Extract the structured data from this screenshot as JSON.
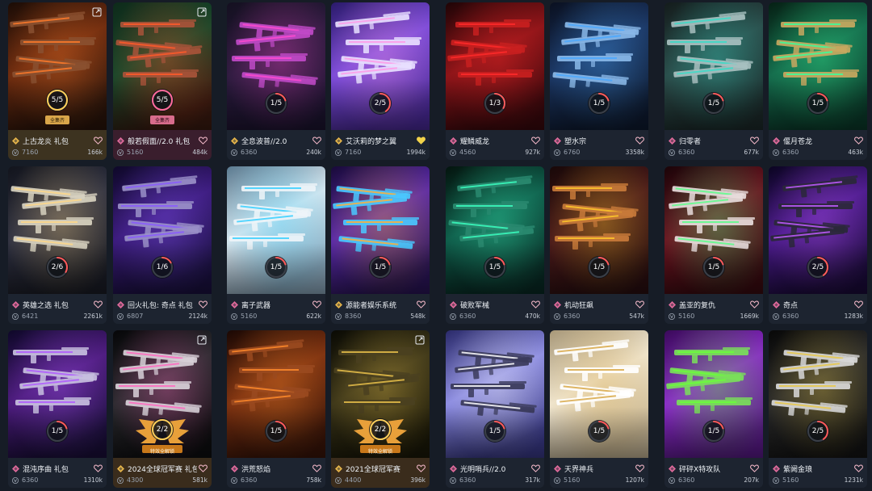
{
  "cards": [
    {
      "name": "上古龙炎 礼包",
      "price": "7160",
      "likes": "166k",
      "progress": "5/5",
      "fraction": 1.0,
      "badge": "全集齐",
      "badge_style": "gold",
      "tier": "exclusive",
      "tier_color": "#e8b64a",
      "liked": false,
      "share": true,
      "info_style": "gold",
      "art": {
        "bg": [
          "#2a140a",
          "#6b2a0e",
          "#1a0c06"
        ],
        "accent": "#ff7a2a",
        "gun": "#8a5030"
      }
    },
    {
      "name": "般若假面//2.0 礼包",
      "price": "5160",
      "likes": "484k",
      "progress": "5/5",
      "fraction": 1.0,
      "badge": "全集齐",
      "badge_style": "pink",
      "tier": "premium",
      "tier_color": "#e06a9c",
      "liked": false,
      "share": true,
      "info_style": "pink",
      "art": {
        "bg": [
          "#3a1a10",
          "#17472a",
          "#0e2a1a"
        ],
        "accent": "#ff5a2a",
        "gun": "#a8543a"
      }
    },
    {
      "name": "全息波普//2.0",
      "price": "6360",
      "likes": "240k",
      "progress": "1/5",
      "fraction": 0.2,
      "tier": "deluxe",
      "tier_color": "#e8b64a",
      "liked": false,
      "share": false,
      "art": {
        "bg": [
          "#1c1430",
          "#2a1a3c",
          "#141020"
        ],
        "accent": "#ff4ad0",
        "gun": "#c04ac8"
      }
    },
    {
      "name": "艾沃莉的梦之翼",
      "price": "7160",
      "likes": "1994k",
      "progress": "2/5",
      "fraction": 0.4,
      "tier": "exclusive",
      "tier_color": "#e8b64a",
      "liked": true,
      "share": false,
      "art": {
        "bg": [
          "#4a2a9a",
          "#7a4ad8",
          "#2a1a6a"
        ],
        "accent": "#ff9ae8",
        "gun": "#e8e0ff"
      }
    },
    {
      "name": "耀鳞威龙",
      "price": "4560",
      "likes": "927k",
      "progress": "1/3",
      "fraction": 0.33,
      "tier": "premium",
      "tier_color": "#e06a9c",
      "liked": false,
      "share": false,
      "art": {
        "bg": [
          "#3a080c",
          "#8a1418",
          "#1e0406"
        ],
        "accent": "#ff2a2a",
        "gun": "#c82020"
      }
    },
    {
      "name": "塑水宗",
      "price": "6760",
      "likes": "3358k",
      "progress": "1/5",
      "fraction": 0.2,
      "tier": "premium",
      "tier_color": "#e06a9c",
      "liked": false,
      "share": false,
      "art": {
        "bg": [
          "#0e1a30",
          "#1a3460",
          "#0a1020"
        ],
        "accent": "#4aa8ff",
        "gun": "#8ab8e8"
      }
    },
    {
      "name": "归零者",
      "price": "6360",
      "likes": "677k",
      "progress": "1/5",
      "fraction": 0.2,
      "tier": "premium",
      "tier_color": "#e06a9c",
      "liked": false,
      "share": false,
      "art": {
        "bg": [
          "#1c2a2a",
          "#2a4a48",
          "#141c1c"
        ],
        "accent": "#3adcc8",
        "gun": "#a8c0c0"
      }
    },
    {
      "name": "偃月苍龙",
      "price": "6360",
      "likes": "463k",
      "progress": "1/5",
      "fraction": 0.2,
      "tier": "premium",
      "tier_color": "#e06a9c",
      "liked": false,
      "share": false,
      "art": {
        "bg": [
          "#0a3a2a",
          "#14684a",
          "#062014"
        ],
        "accent": "#3aff9a",
        "gun": "#c8a860"
      }
    },
    {
      "name": "英雄之选 礼包",
      "price": "6421",
      "likes": "2261k",
      "progress": "2/6",
      "fraction": 0.33,
      "tier": "premium",
      "tier_color": "#e06a9c",
      "liked": false,
      "share": false,
      "art": {
        "bg": [
          "#1a1c26",
          "#2e3040",
          "#12141c"
        ],
        "accent": "#ffd88a",
        "gun": "#d8d2c0"
      }
    },
    {
      "name": "回火礼包: 奇点 礼包",
      "price": "6807",
      "likes": "2124k",
      "progress": "1/6",
      "fraction": 0.17,
      "tier": "premium",
      "tier_color": "#e06a9c",
      "liked": false,
      "share": false,
      "art": {
        "bg": [
          "#1a1040",
          "#3a1a7a",
          "#0e0828"
        ],
        "accent": "#8a5aff",
        "gun": "#9a90c8"
      }
    },
    {
      "name": "离子武器",
      "price": "5160",
      "likes": "622k",
      "progress": "1/5",
      "fraction": 0.2,
      "tier": "premium",
      "tier_color": "#e06a9c",
      "liked": false,
      "share": false,
      "art": {
        "bg": [
          "#8ca8bc",
          "#d8e6ee",
          "#5a7a90"
        ],
        "accent": "#3ad0ff",
        "gun": "#eef4f8"
      }
    },
    {
      "name": "源能者娱乐系统",
      "price": "8360",
      "likes": "548k",
      "progress": "1/5",
      "fraction": 0.2,
      "tier": "exclusive",
      "tier_color": "#e8b64a",
      "liked": false,
      "share": false,
      "art": {
        "bg": [
          "#2a1458",
          "#5a2aa8",
          "#180a38"
        ],
        "accent": "#ffb03a",
        "gun": "#4ac8ff"
      }
    },
    {
      "name": "破败军械",
      "price": "6360",
      "likes": "470k",
      "progress": "1/5",
      "fraction": 0.2,
      "tier": "premium",
      "tier_color": "#e06a9c",
      "liked": false,
      "share": false,
      "art": {
        "bg": [
          "#082a24",
          "#0e5a48",
          "#04140e"
        ],
        "accent": "#3affc0",
        "gun": "#2a8a70"
      }
    },
    {
      "name": "机动狂飙",
      "price": "6360",
      "likes": "547k",
      "progress": "1/5",
      "fraction": 0.2,
      "tier": "premium",
      "tier_color": "#e06a9c",
      "liked": false,
      "share": false,
      "art": {
        "bg": [
          "#2a0e10",
          "#4a1a1a",
          "#180808"
        ],
        "accent": "#ffc82a",
        "gun": "#c87a3a"
      }
    },
    {
      "name": "盖亚的复仇",
      "price": "5160",
      "likes": "1669k",
      "progress": "1/5",
      "fraction": 0.2,
      "tier": "premium",
      "tier_color": "#e06a9c",
      "liked": false,
      "share": false,
      "art": {
        "bg": [
          "#3a0a10",
          "#6a1420",
          "#1a0408"
        ],
        "accent": "#5aff8a",
        "gun": "#e8dcdc"
      }
    },
    {
      "name": "奇点",
      "price": "6360",
      "likes": "1283k",
      "progress": "2/5",
      "fraction": 0.4,
      "tier": "premium",
      "tier_color": "#e06a9c",
      "liked": false,
      "share": false,
      "art": {
        "bg": [
          "#1a0a3a",
          "#4a1a8a",
          "#0a0420"
        ],
        "accent": "#c05aff",
        "gun": "#2a2838"
      }
    },
    {
      "name": "混沌序曲 礼包",
      "price": "6360",
      "likes": "1310k",
      "progress": "1/5",
      "fraction": 0.2,
      "tier": "premium",
      "tier_color": "#e06a9c",
      "liked": false,
      "share": false,
      "art": {
        "bg": [
          "#1a0e3a",
          "#4a1a7a",
          "#0e0828"
        ],
        "accent": "#b05aff",
        "gun": "#c8c0e0"
      }
    },
    {
      "name": "2024全球冠军赛 礼包",
      "price": "4300",
      "likes": "581k",
      "progress": "2/2",
      "fraction": 1.0,
      "tier": "exclusive",
      "tier_color": "#e8b64a",
      "liked": false,
      "share": true,
      "wing": "特效全解锁",
      "info_style": "gold2",
      "art": {
        "bg": [
          "#0e0e10",
          "#2a2a2e",
          "#060608"
        ],
        "accent": "#ff6ac0",
        "gun": "#d8d0d8"
      }
    },
    {
      "name": "洪荒怒焰",
      "price": "6360",
      "likes": "758k",
      "progress": "1/5",
      "fraction": 0.2,
      "tier": "premium",
      "tier_color": "#e06a9c",
      "liked": false,
      "share": false,
      "art": {
        "bg": [
          "#3a1408",
          "#7a3010",
          "#1a0804"
        ],
        "accent": "#ff8a2a",
        "gun": "#9a4a20"
      }
    },
    {
      "name": "2021全球冠军赛",
      "price": "4400",
      "likes": "396k",
      "progress": "2/2",
      "fraction": 1.0,
      "tier": "exclusive",
      "tier_color": "#e8b64a",
      "liked": false,
      "share": true,
      "wing": "特效全解锁",
      "info_style": "gold2",
      "art": {
        "bg": [
          "#1a1808",
          "#3a3418",
          "#0a0a04"
        ],
        "accent": "#e8c04a",
        "gun": "#4a4020"
      }
    },
    {
      "name": "光明哨兵//2.0",
      "price": "6360",
      "likes": "317k",
      "progress": "1/5",
      "fraction": 0.2,
      "tier": "premium",
      "tier_color": "#e06a9c",
      "liked": false,
      "share": false,
      "art": {
        "bg": [
          "#3a3a8a",
          "#8a8ae0",
          "#2a2a6a"
        ],
        "accent": "#ffffff",
        "gun": "#3a3a5a"
      }
    },
    {
      "name": "天界神兵",
      "price": "5160",
      "likes": "1207k",
      "progress": "1/5",
      "fraction": 0.2,
      "tier": "premium",
      "tier_color": "#e06a9c",
      "liked": false,
      "share": false,
      "art": {
        "bg": [
          "#c8b898",
          "#f0e6d0",
          "#a89878"
        ],
        "accent": "#d8a848",
        "gun": "#ffffff"
      }
    },
    {
      "name": "砰砰X特攻队",
      "price": "6360",
      "likes": "207k",
      "progress": "1/5",
      "fraction": 0.2,
      "tier": "premium",
      "tier_color": "#e06a9c",
      "liked": false,
      "share": false,
      "art": {
        "bg": [
          "#5a1a8a",
          "#8a2ac8",
          "#3a0a5a"
        ],
        "accent": "#6aff3a",
        "gun": "#7ae05a"
      }
    },
    {
      "name": "紫阙金琅",
      "price": "5160",
      "likes": "1231k",
      "progress": "2/5",
      "fraction": 0.4,
      "tier": "premium",
      "tier_color": "#e06a9c",
      "liked": false,
      "share": false,
      "art": {
        "bg": [
          "#141414",
          "#2a2a2a",
          "#080808"
        ],
        "accent": "#e8c84a",
        "gun": "#d8d8d8"
      }
    }
  ]
}
